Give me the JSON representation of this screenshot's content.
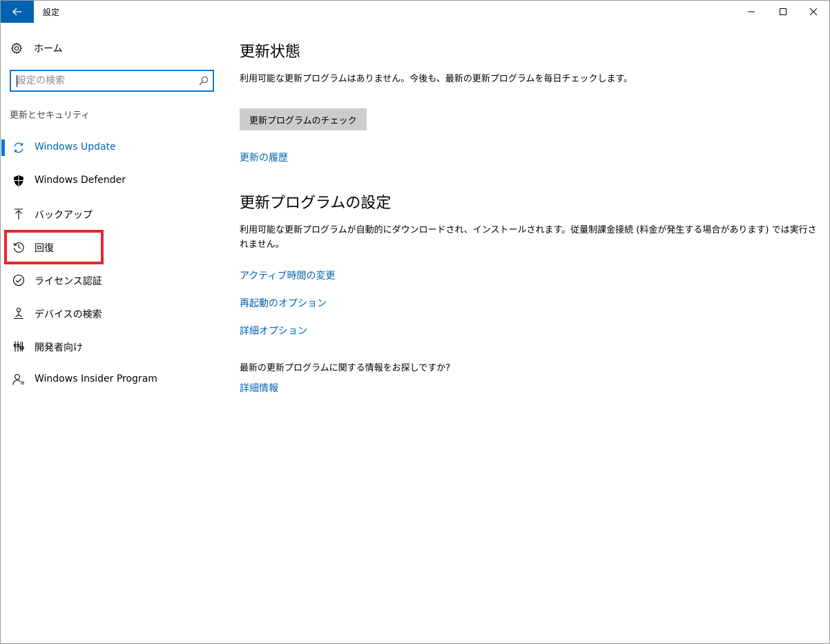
{
  "titlebar": {
    "title": "設定"
  },
  "sidebar": {
    "home_label": "ホーム",
    "search_placeholder": "設定の検索",
    "section_label": "更新とセキュリティ",
    "items": [
      {
        "label": "Windows Update",
        "icon": "sync-icon",
        "active": true
      },
      {
        "label": "Windows Defender",
        "icon": "shield-icon",
        "active": false
      },
      {
        "label": "バックアップ",
        "icon": "upload-arrow-icon",
        "active": false
      },
      {
        "label": "回復",
        "icon": "history-icon",
        "active": false
      },
      {
        "label": "ライセンス認証",
        "icon": "check-circle-icon",
        "active": false
      },
      {
        "label": "デバイスの検索",
        "icon": "person-location-icon",
        "active": false
      },
      {
        "label": "開発者向け",
        "icon": "developer-tools-icon",
        "active": false
      },
      {
        "label": "Windows Insider Program",
        "icon": "insider-person-icon",
        "active": false
      }
    ]
  },
  "main": {
    "status_heading": "更新状態",
    "status_text": "利用可能な更新プログラムはありません。今後も、最新の更新プログラムを毎日チェックします。",
    "check_button": "更新プログラムのチェック",
    "history_link": "更新の履歴",
    "settings_heading": "更新プログラムの設定",
    "settings_text": "利用可能な更新プログラムが自動的にダウンロードされ、インストールされます。従量制課金接続 (料金が発生する場合があります) では実行されません。",
    "active_hours_link": "アクティブ時間の変更",
    "restart_options_link": "再起動のオプション",
    "advanced_options_link": "詳細オプション",
    "info_question": "最新の更新プログラムに関する情報をお探しですか?",
    "more_info_link": "詳細情報"
  },
  "colors": {
    "accent": "#0078d7",
    "link": "#0063b1",
    "highlight": "#e8262d",
    "button_bg": "#cccccc"
  }
}
